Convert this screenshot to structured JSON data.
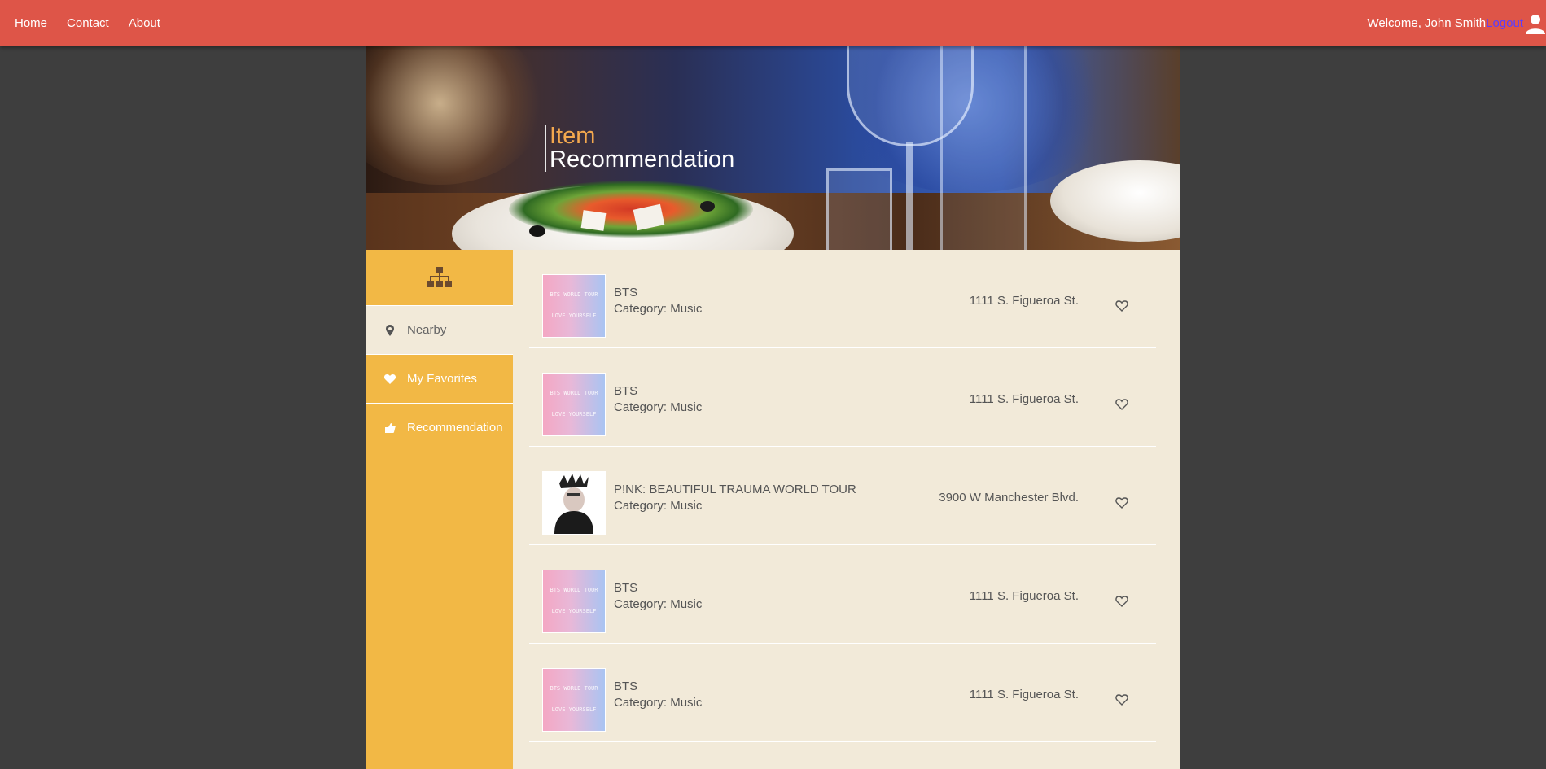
{
  "nav": {
    "links": [
      "Home",
      "Contact",
      "About"
    ],
    "welcome": "Welcome, John Smith",
    "logout": "Logout"
  },
  "hero": {
    "title_line1": "Item",
    "title_line2": "Recommendation"
  },
  "sidebar": {
    "top_icon": "hierarchy-icon",
    "items": [
      {
        "label": "Nearby",
        "icon": "map-pin-icon",
        "active": true
      },
      {
        "label": "My Favorites",
        "icon": "heart-icon",
        "active": false
      },
      {
        "label": "Recommendation",
        "icon": "thumbs-up-icon",
        "active": false
      }
    ]
  },
  "items": [
    {
      "name": "BTS",
      "category": "Category: Music",
      "address": "1111 S. Figueroa St.",
      "thumb": "bts"
    },
    {
      "name": "BTS",
      "category": "Category: Music",
      "address": "1111 S. Figueroa St.",
      "thumb": "bts"
    },
    {
      "name": "P!NK: BEAUTIFUL TRAUMA WORLD TOUR",
      "category": "Category: Music",
      "address": "3900 W Manchester Blvd.",
      "thumb": "pink"
    },
    {
      "name": "BTS",
      "category": "Category: Music",
      "address": "1111 S. Figueroa St.",
      "thumb": "bts"
    },
    {
      "name": "BTS",
      "category": "Category: Music",
      "address": "1111 S. Figueroa St.",
      "thumb": "bts"
    }
  ],
  "colors": {
    "topbar": "#de5548",
    "sidebar": "#f2b845",
    "content_bg": "#f2ead9",
    "title_accent": "#f3a84e"
  }
}
